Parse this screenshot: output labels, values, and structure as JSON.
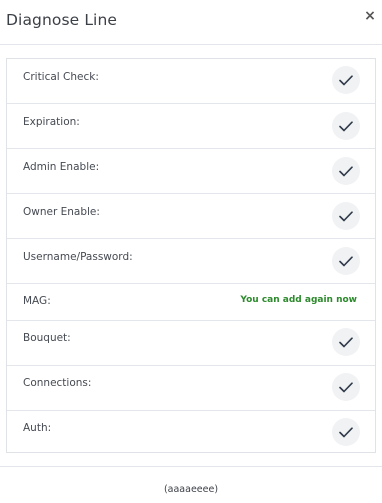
{
  "modal": {
    "title": "Diagnose Line",
    "close_label": "×"
  },
  "checks": [
    {
      "label": "Critical Check:",
      "status": "check-icon"
    },
    {
      "label": "Expiration:",
      "status": "check-icon"
    },
    {
      "label": "Admin Enable:",
      "status": "check-icon"
    },
    {
      "label": "Owner Enable:",
      "status": "check-icon"
    },
    {
      "label": "Username/Password:",
      "status": "check-icon"
    },
    {
      "label": "MAG:",
      "status_text": "You can add again now"
    },
    {
      "label": "Bouquet:",
      "status": "check-icon"
    },
    {
      "label": "Connections:",
      "status": "check-icon"
    },
    {
      "label": "Auth:",
      "status": "check-icon"
    }
  ],
  "footer": {
    "text": "(aaaaeeee)"
  },
  "colors": {
    "success_text": "#2c8a2c",
    "check_stroke": "#2f3a4a"
  }
}
